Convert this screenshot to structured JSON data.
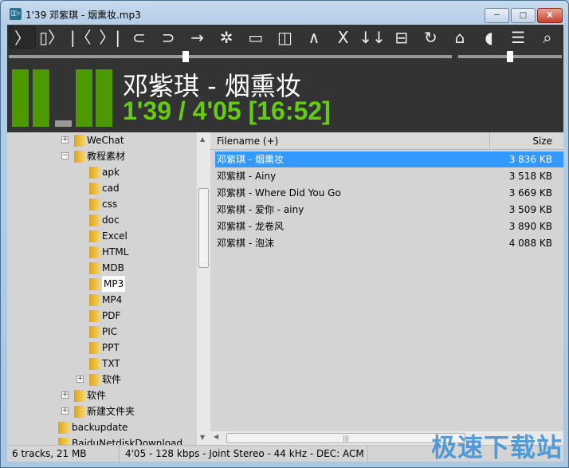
{
  "window": {
    "title": "1'39 邓紫琪 - 烟熏妆.mp3",
    "app_icon": "player-icon",
    "minimize": "─",
    "maximize": "□",
    "close": "X"
  },
  "toolbar": [
    {
      "name": "play-icon",
      "glyph": "〉"
    },
    {
      "name": "pause-play-icon",
      "glyph": "▯〉"
    },
    {
      "name": "previous-track-icon",
      "glyph": "|〈"
    },
    {
      "name": "next-track-icon",
      "glyph": "〉|"
    },
    {
      "name": "folder-back-icon",
      "glyph": "⊂"
    },
    {
      "name": "folder-forward-icon",
      "glyph": "⊃"
    },
    {
      "name": "arrow-right-icon",
      "glyph": "→"
    },
    {
      "name": "gear-icon",
      "glyph": "✲"
    },
    {
      "name": "window-top-icon",
      "glyph": "▭"
    },
    {
      "name": "window-side-icon",
      "glyph": "◫"
    },
    {
      "name": "caret-up-icon",
      "glyph": "∧"
    },
    {
      "name": "close-icon",
      "glyph": "X"
    },
    {
      "name": "sort-down-icon",
      "glyph": "↓↓"
    },
    {
      "name": "split-horizontal-icon",
      "glyph": "⊟"
    },
    {
      "name": "refresh-icon",
      "glyph": "↻"
    },
    {
      "name": "home-icon",
      "glyph": "⌂"
    },
    {
      "name": "volume-icon",
      "glyph": "◖"
    },
    {
      "name": "playlist-select-icon",
      "glyph": "☰"
    },
    {
      "name": "search-icon",
      "glyph": "⌕"
    }
  ],
  "seek": {
    "progress": 0.4
  },
  "volume": {
    "level": 0.5
  },
  "vu": {
    "levels": [
      0.85,
      0.85,
      0.1,
      0.85,
      0.85
    ],
    "color": "#4c9a00"
  },
  "now_playing": {
    "title": "邓紫琪 - 烟熏妆",
    "time": "1'39 / 4'05   [16:52]",
    "time_color": "#66cc11"
  },
  "tree": [
    {
      "label": "WeChat",
      "level": 2,
      "expander": "+"
    },
    {
      "label": "教程素材",
      "level": 2,
      "expander": "−"
    },
    {
      "label": "apk",
      "level": 3
    },
    {
      "label": "cad",
      "level": 3
    },
    {
      "label": "css",
      "level": 3
    },
    {
      "label": "doc",
      "level": 3
    },
    {
      "label": "Excel",
      "level": 3
    },
    {
      "label": "HTML",
      "level": 3
    },
    {
      "label": "MDB",
      "level": 3
    },
    {
      "label": "MP3",
      "level": 3,
      "selected": true
    },
    {
      "label": "MP4",
      "level": 3
    },
    {
      "label": "PDF",
      "level": 3
    },
    {
      "label": "PIC",
      "level": 3
    },
    {
      "label": "PPT",
      "level": 3
    },
    {
      "label": "TXT",
      "level": 3
    },
    {
      "label": "软件",
      "level": 3,
      "expander": "+"
    },
    {
      "label": "软件",
      "level": 2,
      "expander": "+"
    },
    {
      "label": "新建文件夹",
      "level": 2,
      "expander": "+"
    },
    {
      "label": "backupdate",
      "level": 1
    },
    {
      "label": "BaiduNetdiskDownload",
      "level": 1
    }
  ],
  "list": {
    "columns": {
      "filename": "Filename (+)",
      "size": "Size"
    },
    "rows": [
      {
        "name": "邓紫琪 - 烟熏妆",
        "size": "3 836 KB",
        "selected": true
      },
      {
        "name": "邓紫棋 - Ainy",
        "size": "3 518 KB"
      },
      {
        "name": "邓紫棋 - Where Did You Go",
        "size": "3 669 KB"
      },
      {
        "name": "邓紫棋 - 爱你 - ainy",
        "size": "3 509 KB"
      },
      {
        "name": "邓紫棋 - 龙卷风",
        "size": "3 890 KB"
      },
      {
        "name": "邓紫棋 - 泡沫",
        "size": "4 088 KB"
      }
    ]
  },
  "status": {
    "tracks": "6 tracks, 21 MB",
    "info": "4'05 - 128 kbps - Joint Stereo - 44 kHz - DEC: ACM"
  },
  "watermark": "极速下载站"
}
